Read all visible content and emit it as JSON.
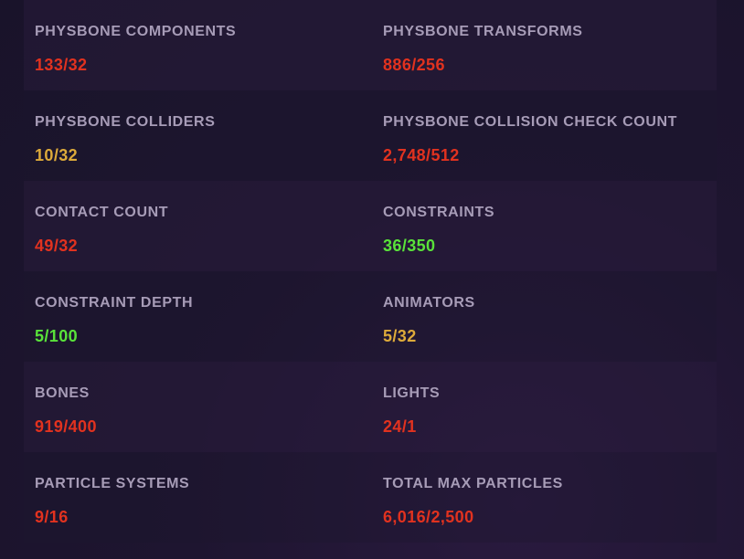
{
  "colors": {
    "over_limit": "#e1321f",
    "warning": "#ddaa3a",
    "ok": "#59e23a",
    "label": "#a79cb7"
  },
  "stats": {
    "physbone_components": {
      "label": "PHYSBONE COMPONENTS",
      "value": "133/32",
      "status": "over_limit"
    },
    "physbone_transforms": {
      "label": "PHYSBONE TRANSFORMS",
      "value": "886/256",
      "status": "over_limit"
    },
    "physbone_colliders": {
      "label": "PHYSBONE COLLIDERS",
      "value": "10/32",
      "status": "warning"
    },
    "physbone_collision_check_count": {
      "label": "PHYSBONE COLLISION CHECK COUNT",
      "value": "2,748/512",
      "status": "over_limit"
    },
    "contact_count": {
      "label": "CONTACT COUNT",
      "value": "49/32",
      "status": "over_limit"
    },
    "constraints": {
      "label": "CONSTRAINTS",
      "value": "36/350",
      "status": "ok"
    },
    "constraint_depth": {
      "label": "CONSTRAINT DEPTH",
      "value": "5/100",
      "status": "ok"
    },
    "animators": {
      "label": "ANIMATORS",
      "value": "5/32",
      "status": "warning"
    },
    "bones": {
      "label": "BONES",
      "value": "919/400",
      "status": "over_limit"
    },
    "lights": {
      "label": "LIGHTS",
      "value": "24/1",
      "status": "over_limit"
    },
    "particle_systems": {
      "label": "PARTICLE SYSTEMS",
      "value": "9/16",
      "status": "over_limit"
    },
    "total_max_particles": {
      "label": "TOTAL MAX PARTICLES",
      "value": "6,016/2,500",
      "status": "over_limit"
    }
  }
}
